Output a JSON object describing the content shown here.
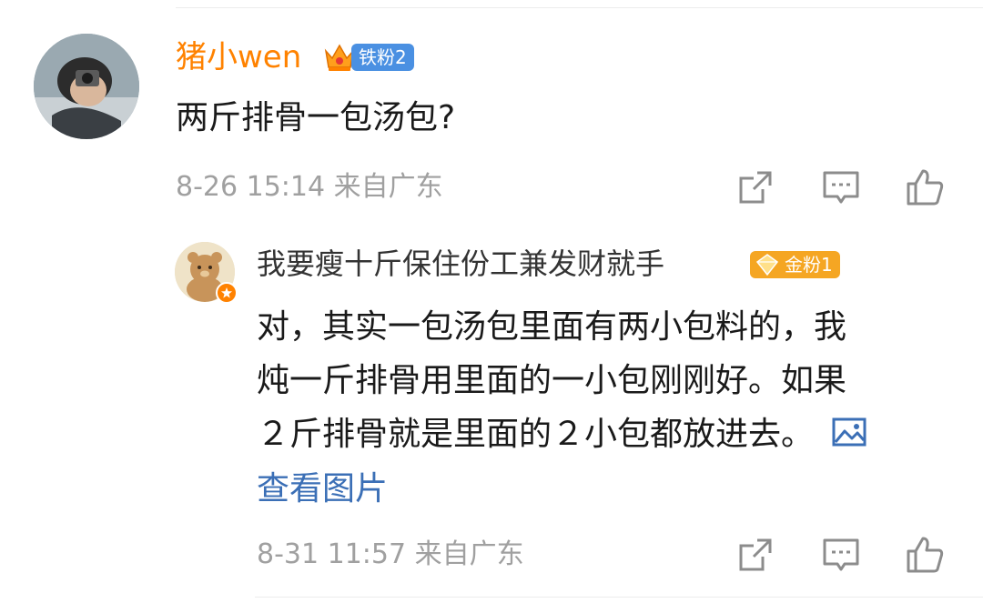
{
  "comment": {
    "username": "猪小wen",
    "fan_badge": "铁粉2",
    "text": "两斤排骨一包汤包?",
    "timestamp": "8-26 15:14",
    "location": "来自广东",
    "avatar_icon": "avatar-photo",
    "crown_icon": "crown-icon"
  },
  "reply": {
    "username": "我要瘦十斤保住份工兼发财就手",
    "fan_badge": "金粉1",
    "text_lines": [
      "对，其实一包汤包里面有两小包料的，我",
      "炖一斤排骨用里面的一小包刚刚好。如果",
      "２斤排骨就是里面的２小包都放进去。"
    ],
    "view_images": "查看图片",
    "timestamp": "8-31 11:57",
    "location": "来自广东"
  },
  "actions": [
    "share-icon",
    "comment-icon",
    "like-icon"
  ],
  "colors": {
    "username_orange": "#ff8200",
    "iron_badge": "#4a90e2",
    "gold_badge": "#f5a623",
    "link_blue": "#3b6fb6",
    "meta_gray": "#a0a0a0"
  }
}
